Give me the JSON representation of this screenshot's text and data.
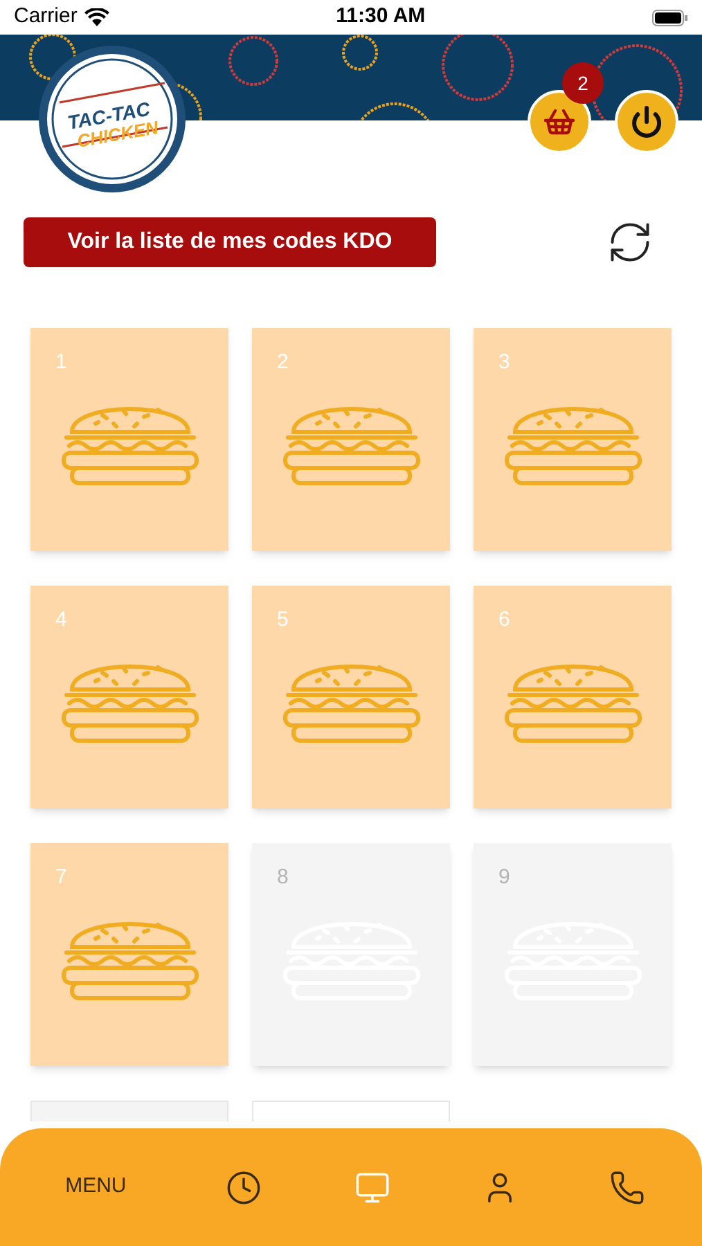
{
  "status_bar": {
    "carrier": "Carrier",
    "time": "11:30 AM"
  },
  "logo": {
    "line_1": "TAC-TAC",
    "line_2": "CHICKEN"
  },
  "cart": {
    "badge": "2"
  },
  "codes_button": "Voir la liste de mes codes KDO",
  "cards": [
    {
      "number": "1",
      "stamped": true
    },
    {
      "number": "2",
      "stamped": true
    },
    {
      "number": "3",
      "stamped": true
    },
    {
      "number": "4",
      "stamped": true
    },
    {
      "number": "5",
      "stamped": true
    },
    {
      "number": "6",
      "stamped": true
    },
    {
      "number": "7",
      "stamped": true
    },
    {
      "number": "8",
      "stamped": false
    },
    {
      "number": "9",
      "stamped": false
    }
  ],
  "partial_cards": [
    {
      "kind": "grey"
    },
    {
      "kind": "white"
    }
  ],
  "nav": [
    {
      "kind": "text",
      "label": "MENU",
      "selected": false
    },
    {
      "kind": "clock",
      "selected": false
    },
    {
      "kind": "monitor",
      "selected": true
    },
    {
      "kind": "user",
      "selected": false
    },
    {
      "kind": "phone",
      "selected": false
    }
  ]
}
